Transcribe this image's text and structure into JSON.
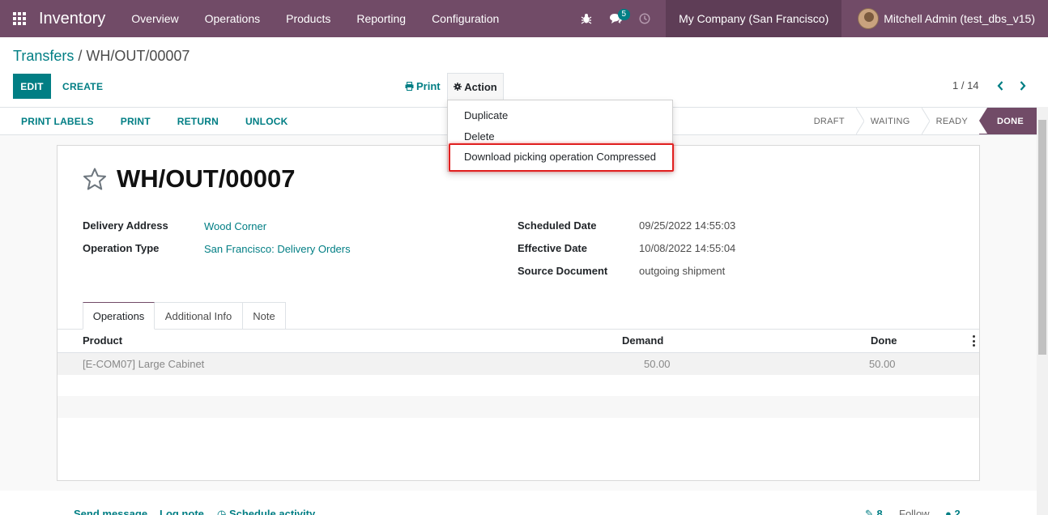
{
  "navbar": {
    "app_name": "Inventory",
    "menu": [
      "Overview",
      "Operations",
      "Products",
      "Reporting",
      "Configuration"
    ],
    "message_count": "5",
    "company": "My Company (San Francisco)",
    "user": "Mitchell Admin (test_dbs_v15)"
  },
  "breadcrumb": {
    "parent": "Transfers",
    "separator": " / ",
    "current": "WH/OUT/00007"
  },
  "control": {
    "edit_label": "EDIT",
    "create_label": "CREATE",
    "print_label": "Print",
    "action_label": "Action",
    "pager": "1 / 14"
  },
  "action_menu": [
    "Duplicate",
    "Delete",
    "Download picking operation Compressed"
  ],
  "statusbar": {
    "buttons": [
      "PRINT LABELS",
      "PRINT",
      "RETURN",
      "UNLOCK"
    ],
    "stages": [
      "DRAFT",
      "WAITING",
      "READY",
      "DONE"
    ],
    "active_stage": "DONE"
  },
  "record": {
    "name": "WH/OUT/00007",
    "left_fields": [
      {
        "label": "Delivery Address",
        "value": "Wood Corner"
      },
      {
        "label": "Operation Type",
        "value": "San Francisco: Delivery Orders"
      }
    ],
    "right_fields": [
      {
        "label": "Scheduled Date",
        "value": "09/25/2022 14:55:03"
      },
      {
        "label": "Effective Date",
        "value": "10/08/2022 14:55:04"
      },
      {
        "label": "Source Document",
        "value": "outgoing shipment"
      }
    ]
  },
  "tabs": [
    "Operations",
    "Additional Info",
    "Note"
  ],
  "table": {
    "columns": [
      "Product",
      "Demand",
      "Done"
    ],
    "rows": [
      {
        "product": "[E-COM07] Large Cabinet",
        "demand": "50.00",
        "done": "50.00"
      }
    ]
  },
  "chatter": {
    "send_message": "Send message",
    "log_note": "Log note",
    "schedule_activity": "Schedule activity",
    "attachments": "8",
    "follow": "Follow",
    "followers": "2"
  },
  "colors": {
    "brand": "#714b67",
    "accent": "#017e84",
    "highlight_border": "#e02020"
  }
}
